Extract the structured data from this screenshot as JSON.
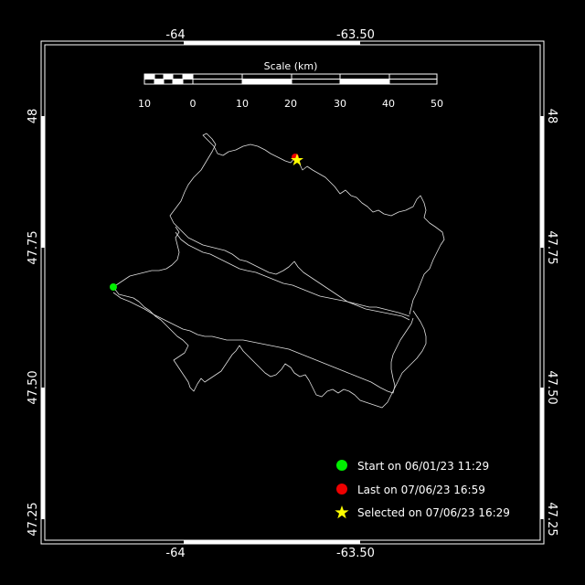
{
  "map": {
    "background_color": "#000000",
    "frame_color": "#ffffff",
    "track_color": "#e0e0e0",
    "longitude_ticks": [
      "-64",
      "-63.50"
    ],
    "latitude_ticks": [
      "48",
      "47.75",
      "47.50",
      "47.25"
    ]
  },
  "scale_bar": {
    "title": "Scale (km)",
    "labels": [
      "10",
      "0",
      "10",
      "20",
      "30",
      "40",
      "50"
    ]
  },
  "legend": {
    "start": {
      "label": "Start on 06/01/23 11:29",
      "color": "#00ee00",
      "icon": "green-circle"
    },
    "last": {
      "label": "Last on 07/06/23 16:59",
      "color": "#ee0000",
      "icon": "red-circle"
    },
    "selected": {
      "label": "Selected on 07/06/23 16:29",
      "color": "#ffff00",
      "icon": "yellow-star"
    }
  }
}
